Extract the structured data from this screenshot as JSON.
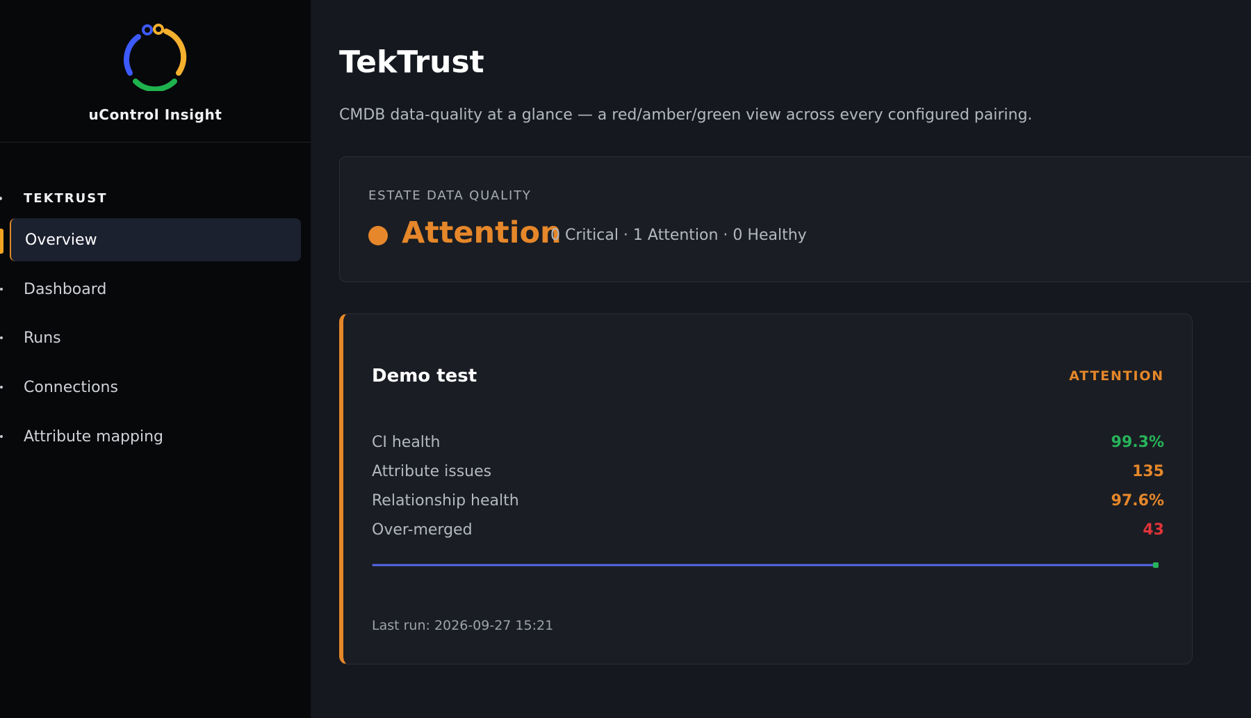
{
  "app": {
    "name": "uControl Insight",
    "logo_icon": "ring-logo-icon",
    "logo_colors": [
      "#3d5afe",
      "#f5b02e",
      "#1fb34e"
    ]
  },
  "sidebar": {
    "section_label": "TEKTRUST",
    "items": [
      {
        "label": "Overview",
        "active": true
      },
      {
        "label": "Dashboard",
        "active": false
      },
      {
        "label": "Runs",
        "active": false
      },
      {
        "label": "Connections",
        "active": false
      },
      {
        "label": "Attribute mapping",
        "active": false
      }
    ]
  },
  "page": {
    "title": "TekTrust",
    "subtitle": "CMDB data-quality at a glance — a red/amber/green view across every configured pairing."
  },
  "estate": {
    "label": "ESTATE DATA QUALITY",
    "status": "Attention",
    "status_color": "#e5872a",
    "counts": "0 Critical · 1 Attention · 0 Healthy"
  },
  "run_card": {
    "title": "Demo test",
    "status": "ATTENTION",
    "metrics": [
      {
        "label": "CI health",
        "value": "99.3%",
        "color": "#27b35a"
      },
      {
        "label": "Attribute issues",
        "value": "135",
        "color": "#e5872a"
      },
      {
        "label": "Relationship health",
        "value": "97.6%",
        "color": "#e5872a"
      },
      {
        "label": "Over-merged",
        "value": "43",
        "color": "#e0343a"
      }
    ],
    "sparkline_color": "#5468e8",
    "last_run": "Last run: 2026-09-27 15:21"
  }
}
